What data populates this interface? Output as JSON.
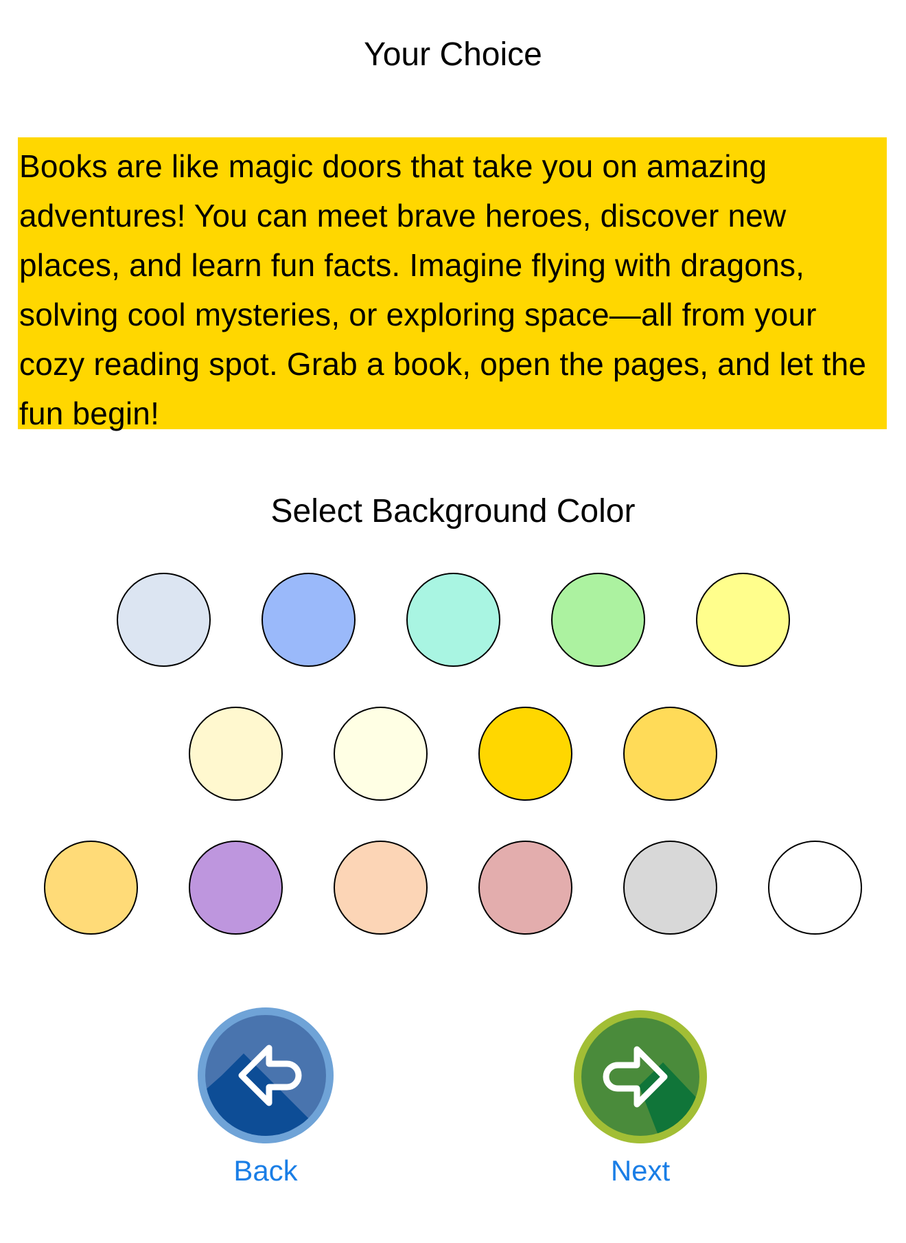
{
  "header": {
    "title": "Your Choice"
  },
  "preview": {
    "text": "Books are like magic doors that take you on amazing adventures! You can meet brave heroes, discover new places, and learn fun facts. Imagine flying with dragons, solving cool mysteries, or exploring space—all from your cozy reading spot. Grab a book, open the pages, and let the fun begin!",
    "background": "#FFD700"
  },
  "color_picker": {
    "title": "Select Background Color",
    "rows": [
      [
        "#DCE5F2",
        "#9AB9FA",
        "#A9F5E2",
        "#ACF2A0",
        "#FFFE8C"
      ],
      [
        "#FFF8CF",
        "#FFFFE4",
        "#FFD700",
        "#FFDB58"
      ],
      [
        "#FFDB78",
        "#BE96DE",
        "#FCD5B6",
        "#E3ADAD",
        "#D8D8D8",
        "#FFFFFF"
      ]
    ]
  },
  "navigation": {
    "back": {
      "label": "Back",
      "icon": "arrow-left-icon",
      "color": "#4974AE",
      "ring": "#6FA3D7",
      "shadow": "#0D4D96"
    },
    "next": {
      "label": "Next",
      "icon": "arrow-right-icon",
      "color": "#4A8B3B",
      "ring": "#A2BE35",
      "shadow": "#107539"
    }
  }
}
